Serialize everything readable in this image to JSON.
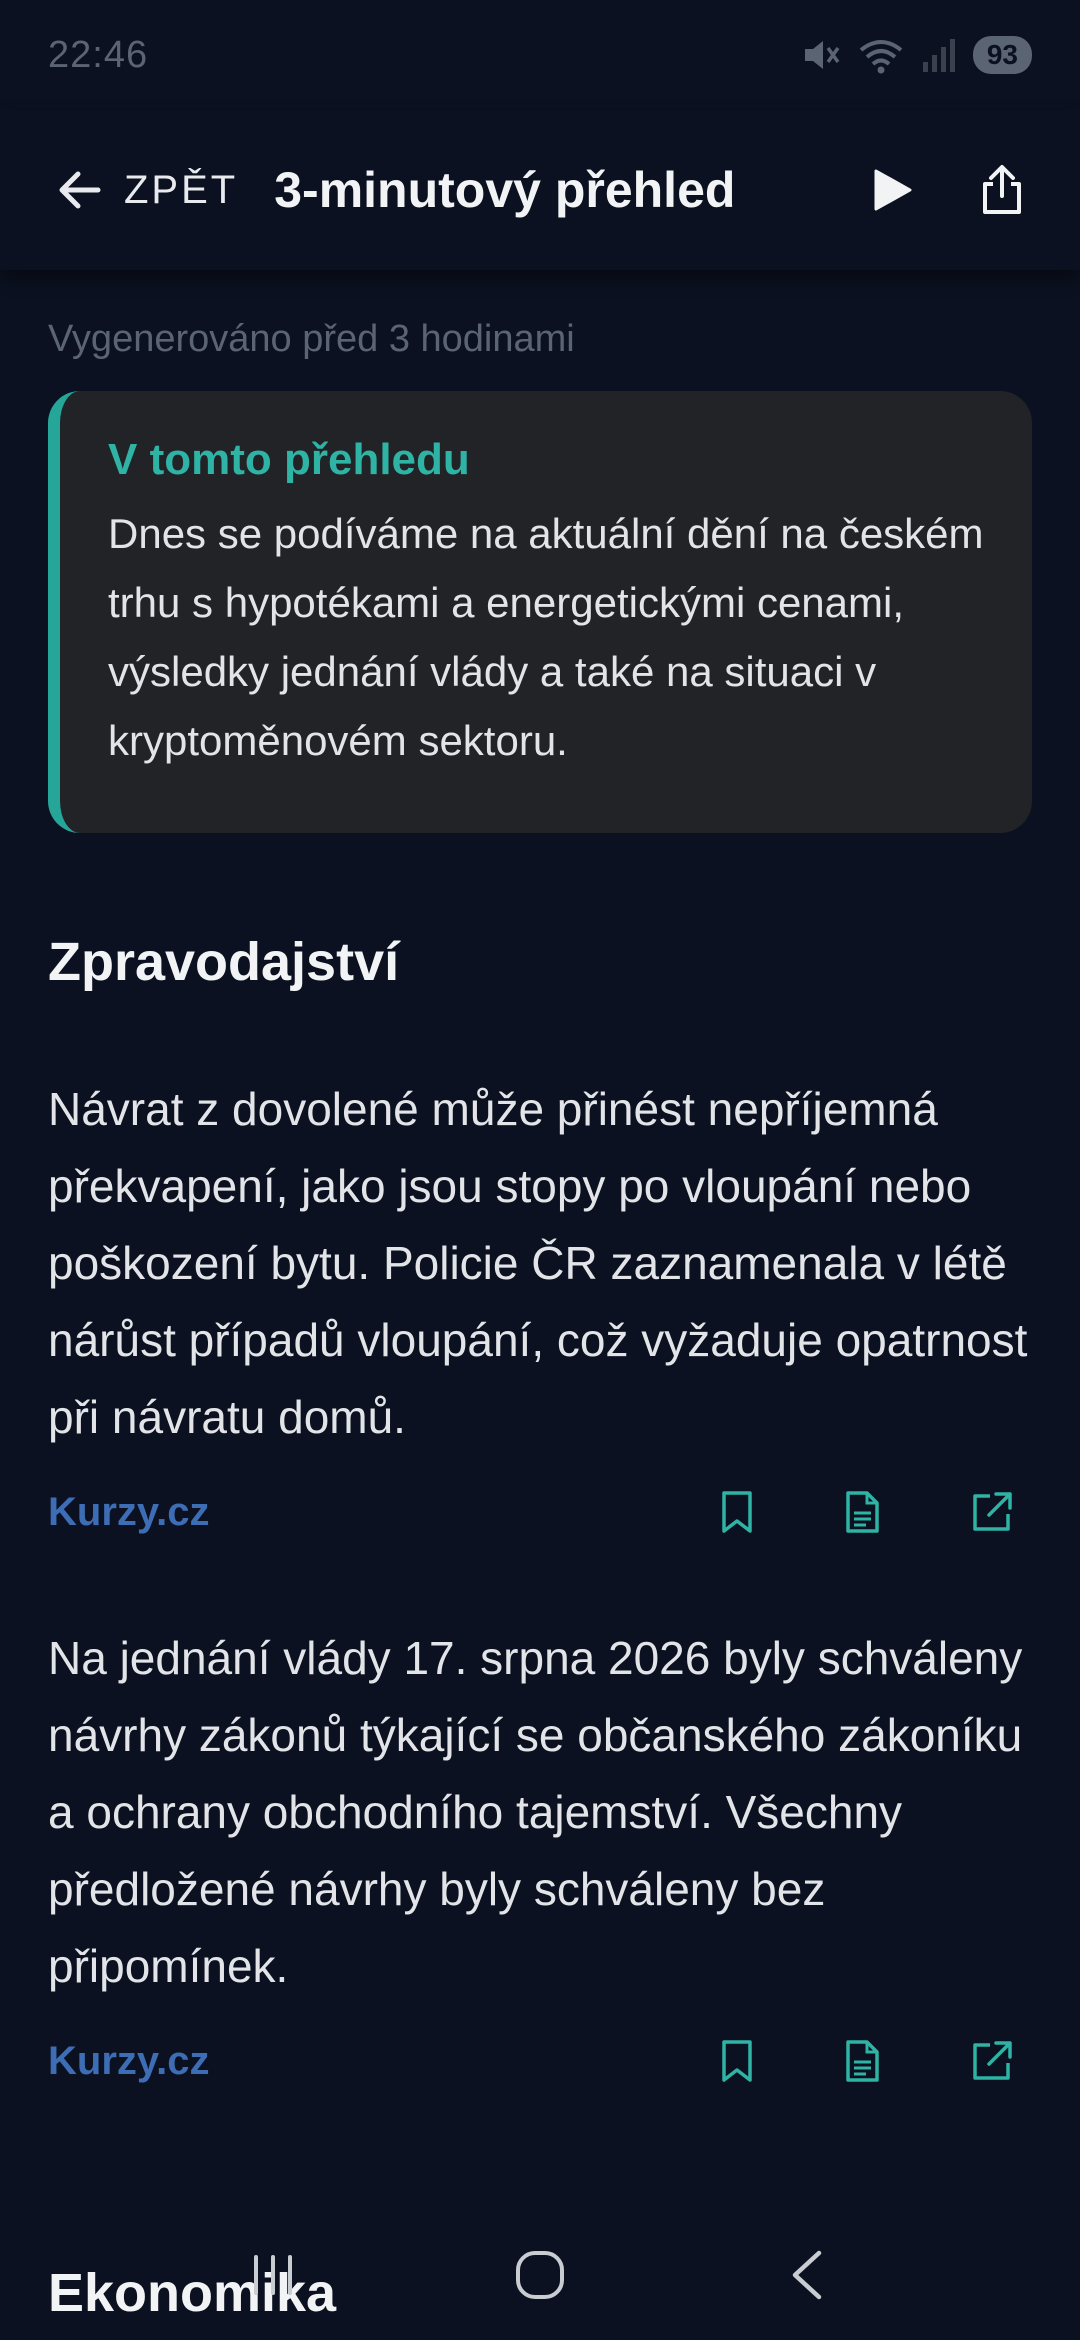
{
  "status_bar": {
    "time": "22:46",
    "battery": "93"
  },
  "header": {
    "back_label": "ZPĚT",
    "title": "3-minutový přehled"
  },
  "generated_note": "Vygenerováno před 3 hodinami",
  "summary": {
    "title": "V tomto přehledu",
    "text": "Dnes se podíváme na aktuální dění na českém trhu s hypotékami a energetickými cenami, výsledky jednání vlády a také na situaci v kryptoměnovém sektoru."
  },
  "sections": [
    {
      "heading": "Zpravodajství",
      "articles": [
        {
          "text": "Návrat z dovolené může přinést nepříjemná překvapení, jako jsou stopy po vloupání nebo poškození bytu. Policie ČR zaznamenala v létě nárůst případů vloupání, což vyžaduje opatrnost při návratu domů.",
          "source": "Kurzy.cz"
        },
        {
          "text": "Na jednání vlády 17. srpna 2026 byly schváleny návrhy zákonů týkající se občanského zákoníku a ochrany obchodního tajemství. Všechny předložené návrhy byly schváleny bez připomínek.",
          "source": "Kurzy.cz"
        }
      ]
    },
    {
      "heading": "Ekonomika"
    }
  ],
  "colors": {
    "background": "#0b1120",
    "accent": "#2fb3a5",
    "link": "#3d6db4",
    "card": "#222327"
  },
  "icons": {
    "back": "arrow-left-icon",
    "play": "play-icon",
    "share": "share-icon",
    "bookmark": "bookmark-icon",
    "document": "document-icon",
    "external": "external-link-icon"
  }
}
